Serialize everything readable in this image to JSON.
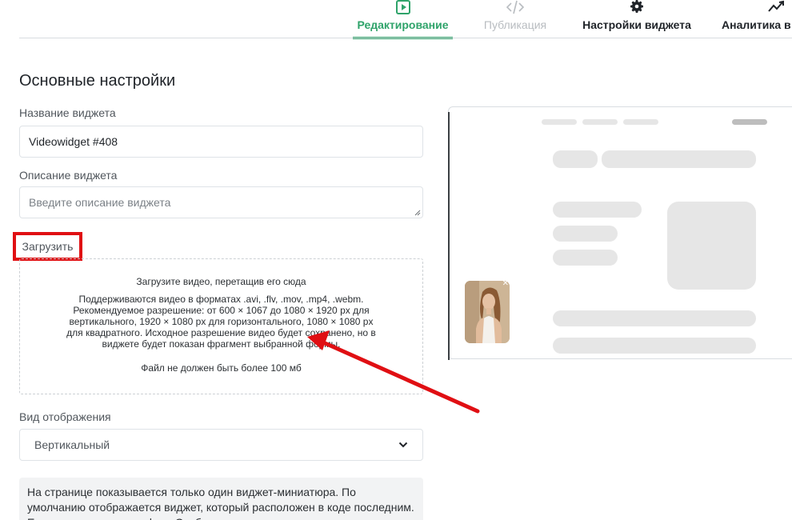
{
  "tabs": [
    {
      "label": "Редактирование",
      "icon": "play-icon",
      "state": "active"
    },
    {
      "label": "Публикация",
      "icon": "code-icon",
      "state": "disabled"
    },
    {
      "label": "Настройки виджета",
      "icon": "gear-icon",
      "state": "normal"
    },
    {
      "label": "Аналитика в",
      "icon": "chart-line-icon",
      "state": "normal"
    }
  ],
  "section_title": "Основные настройки",
  "widget_name": {
    "label": "Название виджета",
    "value": "Videowidget #408"
  },
  "widget_description": {
    "label": "Описание виджета",
    "placeholder": "Введите описание виджета"
  },
  "upload": {
    "label": "Загрузить",
    "title": "Загрузите видео, перетащив его сюда",
    "text": "Поддерживаются видео в форматах .avi, .flv, .mov, .mp4, .webm. Рекомендуемое разрешение: от 600 × 1067 до 1080 × 1920 px для вертикального, 1920 × 1080 px для горизонтального, 1080 × 1080 px для квадратного. Исходное разрешение видео будет сохранено, но в виджете будет показан фрагмент выбранной формы.",
    "limit": "Файл не должен быть более 100 мб"
  },
  "display_mode": {
    "label": "Вид отображения",
    "value": "Вертикальный"
  },
  "info_note": "На странице показывается только один виджет-миниатюра. По умолчанию отображается виджет, который расположен в коде последним. Если у видео включен флаг Отображать один раз, то оно",
  "colors": {
    "accent": "#2fa36a",
    "highlight": "#e00f13",
    "annotation_arrow": "#e00f13"
  }
}
